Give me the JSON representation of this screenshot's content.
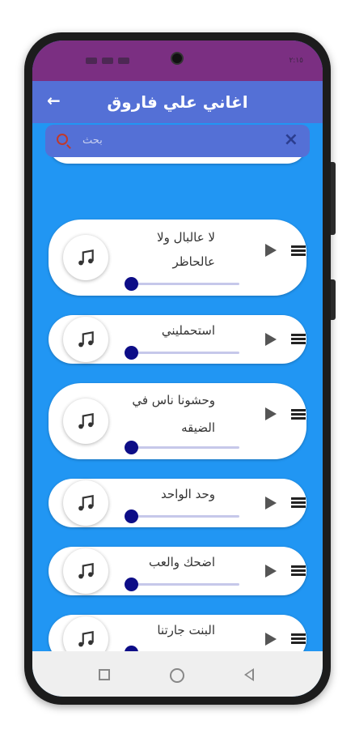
{
  "app": {
    "title": "اغاني علي فاروق",
    "status_time": "٢:١٥"
  },
  "search": {
    "placeholder": "بحث"
  },
  "icons": {
    "back": "arrow-left-icon",
    "search": "search-icon",
    "close": "close-icon",
    "music": "music-note-icon",
    "play": "play-icon",
    "menu": "menu-icon"
  },
  "colors": {
    "status_bar": "#7b2f82",
    "app_bar": "#5470d6",
    "list_background": "#2196f3",
    "seek_knob": "#0d0d87",
    "seek_track": "#c6c8ea"
  },
  "songs": [
    {
      "title_line1": "لا عالبال ولا",
      "title_line2": "عالحاظر",
      "progress": 0
    },
    {
      "title_line1": "استحمليني",
      "title_line2": "",
      "progress": 0
    },
    {
      "title_line1": "وحشونا ناس في",
      "title_line2": "الضيقه",
      "progress": 0
    },
    {
      "title_line1": "وحد الواحد",
      "title_line2": "",
      "progress": 0
    },
    {
      "title_line1": "اضحك والعب",
      "title_line2": "",
      "progress": 0
    },
    {
      "title_line1": "البنت جارتنا",
      "title_line2": "",
      "progress": 0
    }
  ]
}
